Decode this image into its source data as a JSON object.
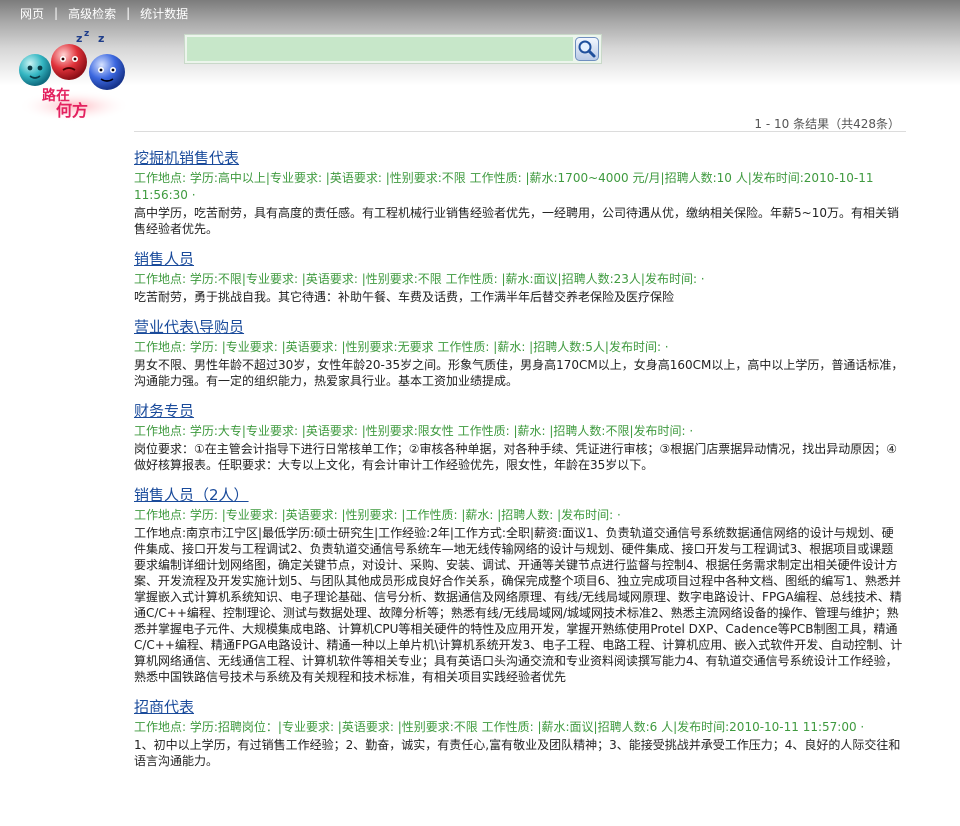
{
  "topnav": {
    "items": [
      "网页",
      "高级检索",
      "统计数据"
    ]
  },
  "logo": {
    "text_line1": "路在",
    "text_line2": "何方"
  },
  "search": {
    "value": "",
    "placeholder": ""
  },
  "result_count": "1 - 10 条结果（共428条）",
  "results": [
    {
      "title": "挖掘机销售代表",
      "meta": "工作地点: 学历:高中以上|专业要求: |英语要求: |性别要求:不限 工作性质: |薪水:1700~4000 元/月|招聘人数:10 人|发布时间:2010-10-11 11:56:30 ·",
      "desc": "高中学历，吃苦耐劳，具有高度的责任感。有工程机械行业销售经验者优先，一经聘用，公司待遇从优，缴纳相关保险。年薪5~10万。有相关销售经验者优先。"
    },
    {
      "title": "销售人员",
      "meta": "工作地点: 学历:不限|专业要求: |英语要求: |性别要求:不限 工作性质: |薪水:面议|招聘人数:23人|发布时间: ·",
      "desc": "吃苦耐劳，勇于挑战自我。其它待遇：补助午餐、车费及话费，工作满半年后替交养老保险及医疗保险"
    },
    {
      "title": "营业代表\\导购员",
      "meta": "工作地点: 学历: |专业要求: |英语要求: |性别要求:无要求 工作性质: |薪水: |招聘人数:5人|发布时间: ·",
      "desc": "男女不限、男性年龄不超过30岁，女性年龄20-35岁之间。形象气质佳，男身高170CM以上，女身高160CM以上，高中以上学历，普通话标准，沟通能力强。有一定的组织能力，热爱家具行业。基本工资加业绩提成。"
    },
    {
      "title": "财务专员",
      "meta": "工作地点: 学历:大专|专业要求: |英语要求: |性别要求:限女性 工作性质: |薪水: |招聘人数:不限|发布时间: ·",
      "desc": "岗位要求：①在主管会计指导下进行日常核单工作；②审核各种单据，对各种手续、凭证进行审核；③根据门店票据异动情况，找出异动原因；④做好核算报表。任职要求：大专以上文化，有会计审计工作经验优先，限女性，年龄在35岁以下。"
    },
    {
      "title": "销售人员（2人）",
      "meta": "工作地点: 学历: |专业要求: |英语要求: |性别要求: |工作性质: |薪水: |招聘人数: |发布时间: ·",
      "desc": "工作地点:南京市江宁区|最低学历:硕士研究生|工作经验:2年|工作方式:全职|薪资:面议1、负责轨道交通信号系统数据通信网络的设计与规划、硬件集成、接口开发与工程调试2、负责轨道交通信号系统车—地无线传输网络的设计与规划、硬件集成、接口开发与工程调试3、根据项目或课题要求编制详细计划网络图，确定关键节点，对设计、采购、安装、调试、开通等关键节点进行监督与控制4、根据任务需求制定出相关硬件设计方案、开发流程及开发实施计划5、与团队其他成员形成良好合作关系，确保完成整个项目6、独立完成项目过程中各种文档、图纸的编写1、熟悉并掌握嵌入式计算机系统知识、电子理论基础、信号分析、数据通信及网络原理、有线/无线局域网原理、数字电路设计、FPGA编程、总线技术、精通C/C++编程、控制理论、测试与数据处理、故障分析等；熟悉有线/无线局域网/城域网技术标准2、熟悉主流网络设备的操作、管理与维护；熟悉并掌握电子元件、大规模集成电路、计算机CPU等相关硬件的特性及应用开发，掌握开熟练使用Protel DXP、Cadence等PCB制图工具，精通C/C++编程、精通FPGA电路设计、精通一种以上单片机\\计算机系统开发3、电子工程、电路工程、计算机应用、嵌入式软件开发、自动控制、计算机网络通信、无线通信工程、计算机软件等相关专业；具有英语口头沟通交流和专业资料阅读撰写能力4、有轨道交通信号系统设计工作经验，熟悉中国铁路信号技术与系统及有关规程和技术标准，有相关项目实践经验者优先"
    },
    {
      "title": "招商代表",
      "meta": "工作地点: 学历:招聘岗位：|专业要求: |英语要求: |性别要求:不限 工作性质: |薪水:面议|招聘人数:6 人|发布时间:2010-10-11 11:57:00 ·",
      "desc": "1、初中以上学历，有过销售工作经验；2、勤奋，诚实，有责任心,富有敬业及团队精神；3、能接受挑战并承受工作压力；4、良好的人际交往和语言沟通能力。"
    }
  ]
}
